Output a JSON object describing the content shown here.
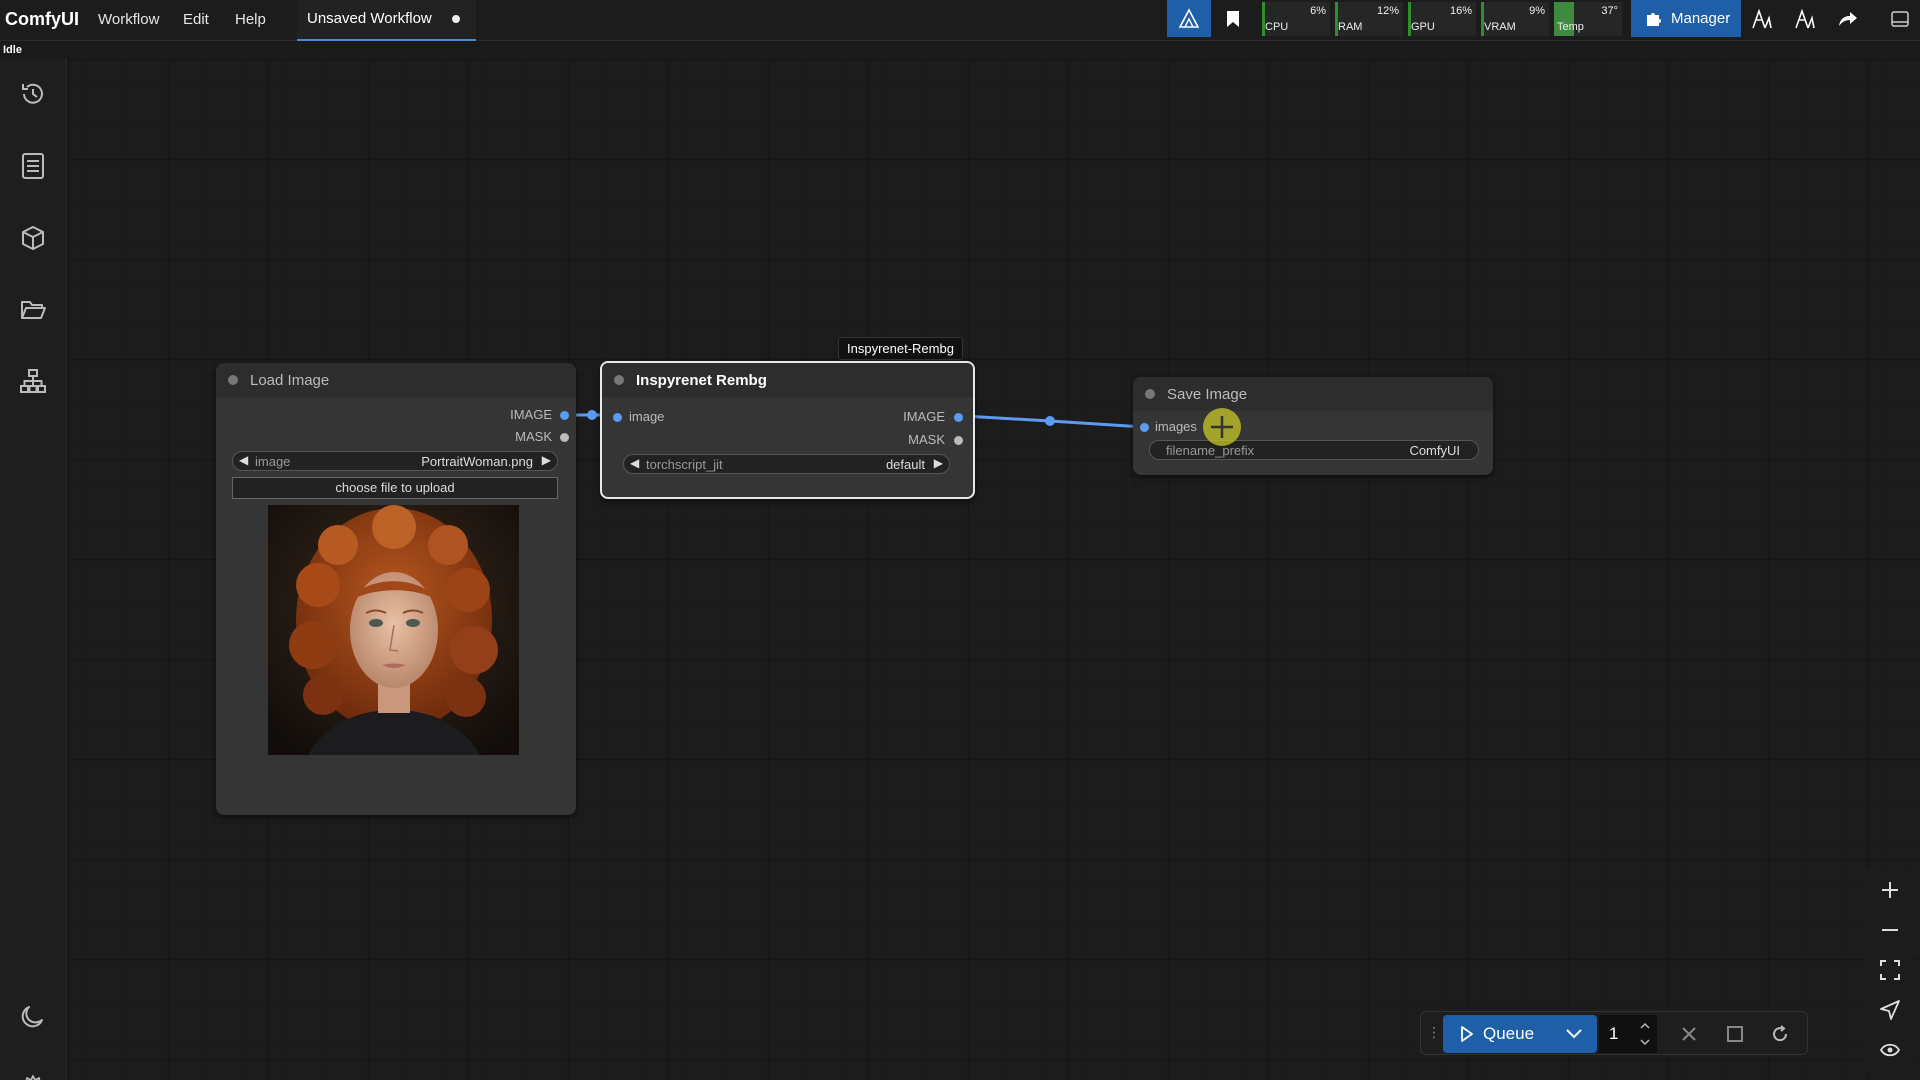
{
  "app": {
    "brand": "ComfyUI",
    "status": "Idle"
  },
  "menu": {
    "workflow": "Workflow",
    "edit": "Edit",
    "help": "Help"
  },
  "tab": {
    "label": "Unsaved Workflow"
  },
  "monitors": [
    {
      "label": "CPU",
      "value": "6%",
      "level": 0.06
    },
    {
      "label": "RAM",
      "value": "12%",
      "level": 0.12
    },
    {
      "label": "GPU",
      "value": "16%",
      "level": 0.16
    },
    {
      "label": "VRAM",
      "value": "9%",
      "level": 0.09
    },
    {
      "label": "Temp",
      "value": "37°",
      "level": 0.37
    }
  ],
  "manager": {
    "label": "Manager"
  },
  "nodes": {
    "load_image": {
      "title": "Load Image",
      "outputs": [
        "IMAGE",
        "MASK"
      ],
      "widget_name": "image",
      "widget_value": "PortraitWoman.png",
      "upload_label": "choose file to upload"
    },
    "rembg": {
      "title": "Inspyrenet Rembg",
      "tooltip": "Inspyrenet-Rembg",
      "input": "image",
      "outputs": [
        "IMAGE",
        "MASK"
      ],
      "widget_name": "torchscript_jit",
      "widget_value": "default"
    },
    "save_image": {
      "title": "Save Image",
      "input": "images",
      "widget_name": "filename_prefix",
      "widget_value": "ComfyUI"
    }
  },
  "queue": {
    "label": "Queue",
    "count": "1"
  },
  "colors": {
    "accent": "#1f5fa8",
    "link": "#5b9bf0",
    "monitor_bar": "#2f8f2f"
  }
}
